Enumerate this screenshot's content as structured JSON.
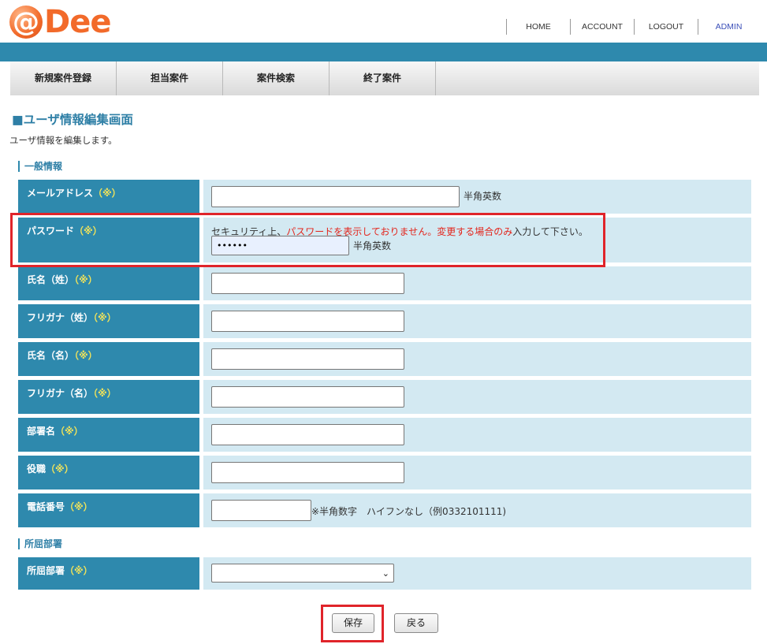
{
  "logo": {
    "at": "@",
    "text": "Dee"
  },
  "topnav": [
    "HOME",
    "ACCOUNT",
    "LOGOUT",
    "ADMIN"
  ],
  "menu": [
    "新規案件登録",
    "担当案件",
    "案件検索",
    "終了案件"
  ],
  "page": {
    "title": "■ユーザ情報編集画面",
    "description": "ユーザ情報を編集します。"
  },
  "sections": {
    "general": "一般情報",
    "department": "所屈部署"
  },
  "required_mark": "（※）",
  "fields": {
    "email": {
      "label": "メールアドレス",
      "value": "",
      "hint": "半角英数"
    },
    "password": {
      "label": "パスワード",
      "notice_prefix": "セキュリティ上、",
      "notice_red": "パスワードを表示しておりません。変更する場合のみ",
      "notice_suffix": "入力して下さい。",
      "value": "••••••",
      "hint": "半角英数"
    },
    "last_name": {
      "label": "氏名（姓）",
      "value": ""
    },
    "last_name_kana": {
      "label": "フリガナ（姓）",
      "value": ""
    },
    "first_name": {
      "label": "氏名（名）",
      "value": ""
    },
    "first_name_kana": {
      "label": "フリガナ（名）",
      "value": ""
    },
    "department_name": {
      "label": "部署名",
      "value": ""
    },
    "position": {
      "label": "役職",
      "value": ""
    },
    "phone": {
      "label": "電話番号",
      "value": "",
      "hint": "※半角数字　ハイフンなし（例0332101111)"
    },
    "affiliation": {
      "label": "所屈部署",
      "selected": ""
    }
  },
  "buttons": {
    "save": "保存",
    "back": "戻る"
  },
  "colors": {
    "brand_orange": "#f26a2a",
    "header_blue": "#2e89ad",
    "value_bg": "#d3e9f2",
    "required_yellow": "#f1e35a",
    "warning_red": "#e3261d",
    "highlight_red": "#e0242a"
  }
}
